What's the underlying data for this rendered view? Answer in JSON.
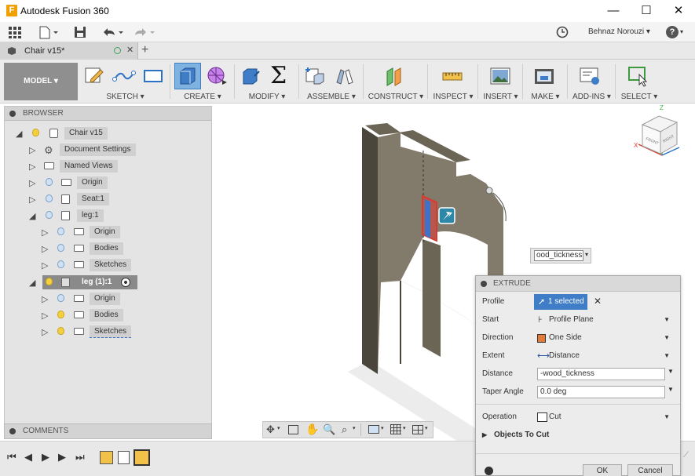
{
  "window": {
    "title": "Autodesk Fusion 360",
    "app_icon": "F",
    "minimize": "—",
    "maximize": "☐",
    "close": "✕"
  },
  "qat": {
    "user": "Behnaz Norouzi ▾",
    "help": "?"
  },
  "doc_tab": {
    "label": "Chair v15*",
    "close": "✕",
    "add": "+"
  },
  "ribbon": {
    "model_button": "MODEL ▾",
    "groups": [
      "SKETCH ▾",
      "CREATE ▾",
      "MODIFY ▾",
      "ASSEMBLE ▾",
      "CONSTRUCT ▾",
      "INSPECT ▾",
      "INSERT ▾",
      "MAKE ▾",
      "ADD-INS ▾",
      "SELECT ▾"
    ]
  },
  "browser": {
    "title": "BROWSER",
    "nodes": [
      {
        "label": "Chair v15"
      },
      {
        "label": "Document Settings"
      },
      {
        "label": "Named Views"
      },
      {
        "label": "Origin"
      },
      {
        "label": "Seat:1"
      },
      {
        "label": "leg:1"
      },
      {
        "label": "Origin"
      },
      {
        "label": "Bodies"
      },
      {
        "label": "Sketches"
      },
      {
        "label": "leg (1):1"
      },
      {
        "label": "Origin"
      },
      {
        "label": "Bodies"
      },
      {
        "label": "Sketches"
      }
    ]
  },
  "comments": {
    "title": "COMMENTS"
  },
  "viewcube": {
    "front": "FRONT",
    "right": "RIGHT"
  },
  "tooltip_input": {
    "value": "ood_tickness"
  },
  "extrude": {
    "title": "EXTRUDE",
    "rows": [
      {
        "label": "Profile",
        "value": "1 selected"
      },
      {
        "label": "Start",
        "value": "Profile Plane"
      },
      {
        "label": "Direction",
        "value": "One Side"
      },
      {
        "label": "Extent",
        "value": "Distance"
      },
      {
        "label": "Distance",
        "value": "-wood_tickness"
      },
      {
        "label": "Taper Angle",
        "value": "0.0 deg"
      },
      {
        "label": "Operation",
        "value": "Cut"
      }
    ],
    "objects_to_cut": "Objects To Cut",
    "ok": "OK",
    "cancel": "Cancel"
  }
}
